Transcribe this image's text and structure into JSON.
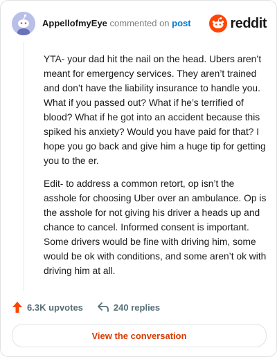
{
  "header": {
    "username": "AppellofmyEye",
    "action_text": "commented on",
    "post_link": "post",
    "brand": "reddit"
  },
  "comment": {
    "paragraphs": [
      "YTA- your dad hit the nail on the head. Ubers aren’t meant for emergency services. They aren’t trained and don’t have the liability insurance to handle you. What if you passed out? What if he’s terrified of blood? What if he got into an accident because this spiked his anxiety? Would you have paid for that? I hope you go back and give him a huge tip for getting you to the er.",
      "Edit- to address a common retort, op isn’t the asshole for choosing Uber over an ambulance. Op is the asshole for not giving his driver a heads up and chance to cancel. Informed consent is important. Some drivers would be fine with driving him, some would be ok with conditions, and some aren’t ok with driving him at all."
    ]
  },
  "actions": {
    "upvotes": "6.3K upvotes",
    "replies": "240 replies"
  },
  "cta": {
    "label": "View the conversation"
  },
  "icons": {
    "avatar": "snoo-avatar-icon",
    "brand": "reddit-logo-icon",
    "upvote": "upvote-arrow-icon",
    "reply": "reply-arrow-icon"
  },
  "colors": {
    "brand_orange": "#ff4500",
    "upvote": "#ff4500",
    "link_blue": "#0079d3",
    "cta_text": "#d93a00",
    "avatar_bg": "#b8bfe8"
  }
}
